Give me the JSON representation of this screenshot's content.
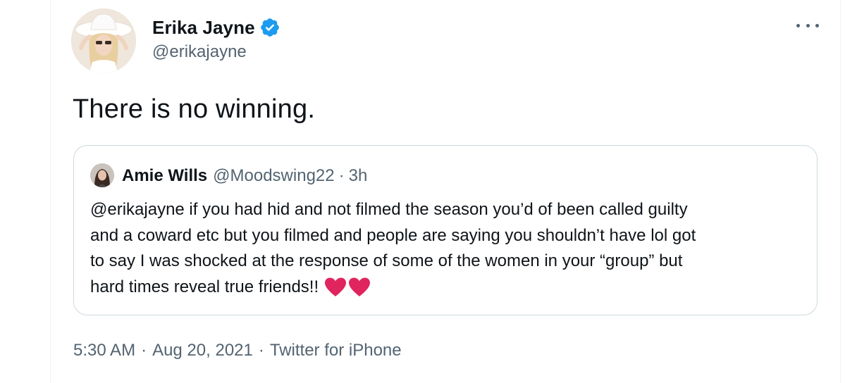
{
  "author": {
    "name": "Erika Jayne",
    "handle": "@erikajayne",
    "verified": true
  },
  "tweet": {
    "text": "There is no winning."
  },
  "quoted": {
    "name": "Amie Wills",
    "handle": "@Moodswing22",
    "separator": "·",
    "time": "3h",
    "lines": [
      "@erikajayne if you had hid and not filmed the season you’d of been called guilty",
      "and a coward etc but you filmed and people are saying you shouldn’t have lol got",
      "to say I was shocked at the response of some of the women in your “group” but",
      "hard times reveal true friends!!"
    ],
    "emoji": [
      "red-heart",
      "red-heart"
    ]
  },
  "meta": {
    "time": "5:30 AM",
    "separator": "·",
    "date": "Aug 20, 2021",
    "source": "Twitter for iPhone"
  },
  "colors": {
    "text": "#0f1419",
    "secondary": "#536471",
    "verified": "#1d9bf0",
    "border": "#cfd9de",
    "heart": "#e0245e"
  },
  "icons": {
    "verified": "verified-badge-icon",
    "more": "more-options-icon",
    "heart": "heart-icon"
  }
}
